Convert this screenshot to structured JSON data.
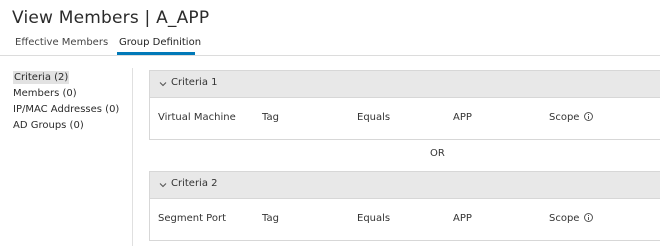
{
  "page": {
    "title": "View Members | A_APP"
  },
  "tabs": [
    {
      "label": "Effective Members",
      "active": false
    },
    {
      "label": "Group Definition",
      "active": true
    }
  ],
  "sidebar": {
    "items": [
      {
        "label": "Criteria (2)",
        "active": true
      },
      {
        "label": "Members (0)",
        "active": false
      },
      {
        "label": "IP/MAC Addresses (0)",
        "active": false
      },
      {
        "label": "AD Groups (0)",
        "active": false
      }
    ]
  },
  "criteria": [
    {
      "title": "Criteria 1",
      "type": "Virtual Machine",
      "key": "Tag",
      "operator": "Equals",
      "value": "APP",
      "scope_label": "Scope"
    },
    {
      "title": "Criteria 2",
      "type": "Segment Port",
      "key": "Tag",
      "operator": "Equals",
      "value": "APP",
      "scope_label": "Scope"
    }
  ],
  "conjunction": "OR",
  "colors": {
    "accent": "#0079b8",
    "header_bg": "#e8e8e8",
    "active_bg": "#e2e2e2"
  },
  "icons": [
    "chevron-down-icon",
    "info-icon"
  ]
}
